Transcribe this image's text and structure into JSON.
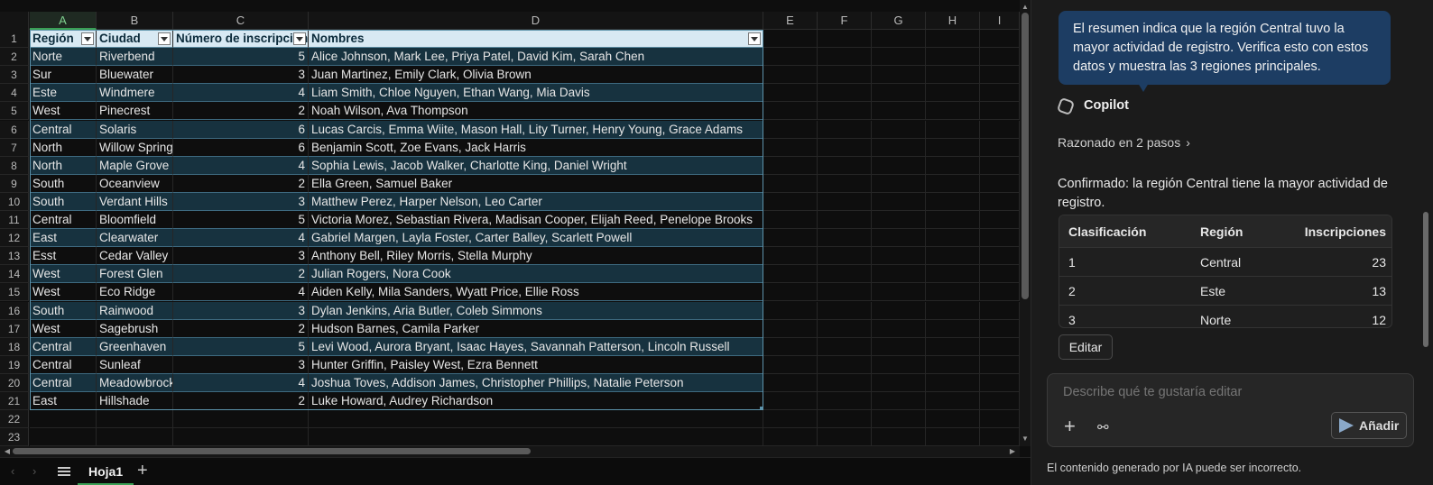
{
  "sheet": {
    "columns": [
      "A",
      "B",
      "C",
      "D",
      "E",
      "F",
      "G",
      "H",
      "I"
    ],
    "selected_column": "A",
    "headers": [
      "Región",
      "Ciudad",
      "Número de inscripciones",
      "Nombres"
    ],
    "rows": [
      [
        "Norte",
        "Riverbend",
        "5",
        "Alice Johnson, Mark Lee, Priya Patel, David Kim, Sarah Chen"
      ],
      [
        "Sur",
        "Bluewater",
        "3",
        "Juan Martinez, Emily Clark, Olivia Brown"
      ],
      [
        "Este",
        "Windmere",
        "4",
        "Liam Smith, Chloe Nguyen, Ethan Wang, Mia Davis"
      ],
      [
        "West",
        "Pinecrest",
        "2",
        "Noah Wilson, Ava Thompson"
      ],
      [
        "Central",
        "Solaris",
        "6",
        "Lucas Carcis, Emma Wiite, Mason Hall, Lity Turner, Henry Young, Grace Adams"
      ],
      [
        "North",
        "Willow Spring",
        "6",
        "Benjamin Scott, Zoe Evans, Jack Harris"
      ],
      [
        "North",
        "Maple Grove",
        "4",
        "Sophia Lewis, Jacob Walker, Charlotte King, Daniel Wright"
      ],
      [
        "South",
        "Oceanview",
        "2",
        "Ella Green, Samuel Baker"
      ],
      [
        "South",
        "Verdant Hills",
        "3",
        "Matthew Perez, Harper Nelson, Leo Carter"
      ],
      [
        "Central",
        "Bloomfield",
        "5",
        "Victoria Morez, Sebastian Rivera, Madisan Cooper, Elijah Reed, Penelope Brooks"
      ],
      [
        "East",
        "Clearwater",
        "4",
        "Gabriel Margen, Layla Foster, Carter Balley, Scarlett Powell"
      ],
      [
        "Esst",
        "Cedar Valley",
        "3",
        "Anthony Bell, Riley Morris, Stella Murphy"
      ],
      [
        "West",
        "Forest Glen",
        "2",
        "Julian Rogers, Nora Cook"
      ],
      [
        "West",
        "Eco Ridge",
        "4",
        "Aiden Kelly, Mila Sanders, Wyatt Price, Ellie Ross"
      ],
      [
        "South",
        "Rainwood",
        "3",
        "Dylan Jenkins, Aria Butler, Coleb Simmons"
      ],
      [
        "West",
        "Sagebrush",
        "2",
        "Hudson Barnes, Camila Parker"
      ],
      [
        "Central",
        "Greenhaven",
        "5",
        "Levi Wood, Aurora Bryant, Isaac Hayes, Savannah Patterson, Lincoln Russell"
      ],
      [
        "Central",
        "Sunleaf",
        "3",
        "Hunter Griffin, Paisley West, Ezra Bennett"
      ],
      [
        "Central",
        "Meadowbrock",
        "4",
        "Joshua Toves, Addison James, Christopher Phillips, Natalie Peterson"
      ],
      [
        "East",
        "Hillshade",
        "2",
        "Luke Howard, Audrey Richardson"
      ]
    ],
    "row_numbers": [
      "1",
      "2",
      "3",
      "4",
      "5",
      "6",
      "7",
      "8",
      "9",
      "10",
      "11",
      "12",
      "13",
      "14",
      "15",
      "16",
      "17",
      "18",
      "19",
      "20",
      "21",
      "22",
      "23"
    ],
    "sheet_tab": "Hoja1"
  },
  "copilot": {
    "user_message": "El resumen indica que la región Central tuvo la mayor actividad de registro. Verifica esto con estos datos y muestra las 3 regiones principales.",
    "assistant_name": "Copilot",
    "reasoning": "Razonado en 2 pasos",
    "answer": "Confirmado: la región Central tiene la mayor actividad de registro.",
    "table": {
      "headers": [
        "Clasificación",
        "Región",
        "Inscripciones"
      ],
      "rows": [
        [
          "1",
          "Central",
          "23"
        ],
        [
          "2",
          "Este",
          "13"
        ],
        [
          "3",
          "Norte",
          "12"
        ]
      ]
    },
    "edit_label": "Editar",
    "composer_placeholder": "Describe qué te gustaría editar",
    "add_label": "Añadir",
    "disclaimer": "El contenido generado por IA puede ser incorrecto."
  },
  "colors": {
    "table_header": "#d8e9f3",
    "table_band": "#17323f",
    "accent_green": "#3aa055",
    "user_bubble": "#1d3d63"
  }
}
